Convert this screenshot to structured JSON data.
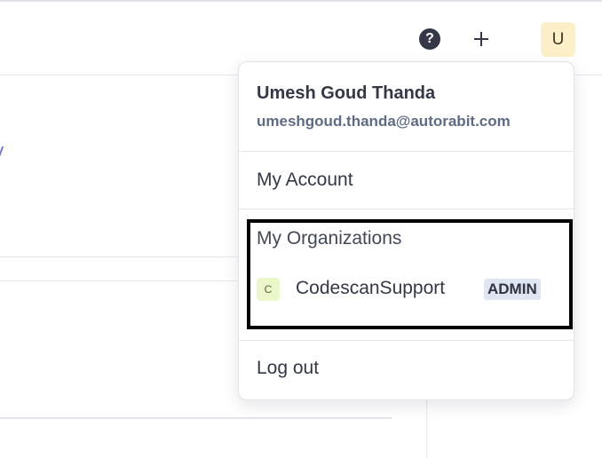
{
  "header": {
    "help_icon": "help-circle-icon",
    "help_glyph": "?",
    "add_icon": "plus-icon",
    "avatar_initial": "U"
  },
  "user_menu": {
    "name": "Umesh Goud Thanda",
    "email": "umeshgoud.thanda@autorabit.com",
    "my_account_label": "My Account",
    "organizations": {
      "heading": "My Organizations",
      "items": [
        {
          "initial": "C",
          "name": "CodescanSupport",
          "role": "ADMIN"
        }
      ]
    },
    "logout_label": "Log out"
  },
  "colors": {
    "avatar_bg": "#fdf0c9",
    "org_icon_bg": "#eaf7c8",
    "role_badge_bg": "#dfe6f1",
    "highlight_border": "#000000"
  }
}
